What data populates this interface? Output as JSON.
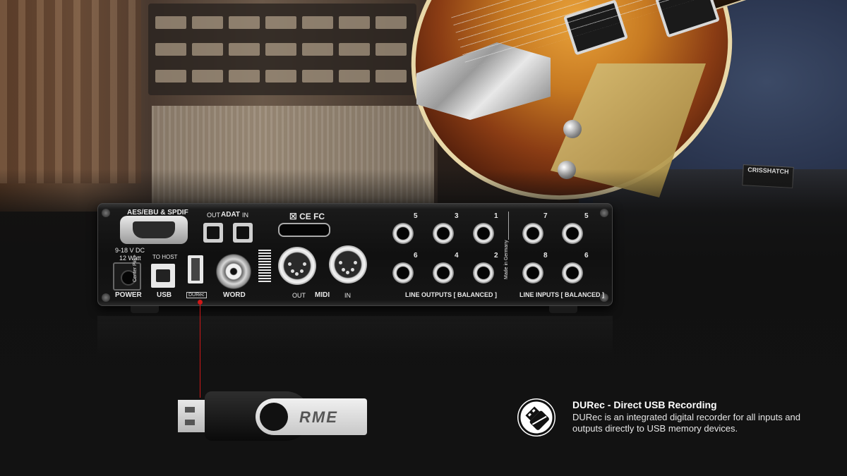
{
  "device": {
    "aes_label": "AES/EBU & SPDIF",
    "adat_out_label": "OUT",
    "adat_label": "ADAT",
    "adat_in_label": "IN",
    "certifications": "☒ CE FC",
    "power_spec_1": "9-18 V DC",
    "power_spec_2": "12 Watt",
    "center_pin_label": "Center Pin +",
    "to_host_label": "TO HOST",
    "power_label": "POWER",
    "usb_label": "USB",
    "durec_label": "DURec",
    "word_label": "WORD",
    "midi_out_label": "OUT",
    "midi_label": "MIDI",
    "midi_in_label": "IN",
    "line_outputs_label": "LINE OUTPUTS [ BALANCED ]",
    "line_inputs_label": "LINE INPUTS [ BALANCED ]",
    "made_in_label": "Made in Germany",
    "output_numbers_top": [
      "5",
      "3",
      "1"
    ],
    "output_numbers_bottom": [
      "6",
      "4",
      "2"
    ],
    "input_numbers_top": [
      "7",
      "5"
    ],
    "input_numbers_bottom": [
      "8",
      "6"
    ]
  },
  "background": {
    "shirt_label": "CRISSHATCH"
  },
  "usb_stick": {
    "logo": "RME"
  },
  "feature": {
    "title": "DURec - Direct USB Recording",
    "description": "DURec is an integrated digital recorder for all inputs and outputs directly to USB memory devices."
  },
  "colors": {
    "accent_line": "#d01818",
    "text": "#ffffff"
  }
}
